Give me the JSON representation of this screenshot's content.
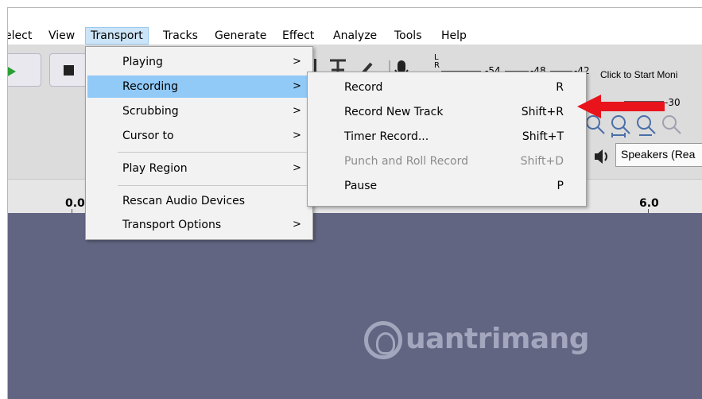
{
  "menubar": {
    "items": [
      "elect",
      "View",
      "Transport",
      "Tracks",
      "Generate",
      "Effect",
      "Analyze",
      "Tools",
      "Help"
    ],
    "open_index": 2
  },
  "meter": {
    "record_label": "L\nR",
    "scale_top": [
      "-54",
      "-48",
      "-42"
    ],
    "scale_bottom": [
      "-30"
    ],
    "monitor_text": "Click to Start Moni"
  },
  "device": {
    "speakers": "Speakers (Rea"
  },
  "ruler": {
    "labels": [
      "0.0",
      "6.0"
    ]
  },
  "transport_menu": {
    "items": [
      {
        "label": "Playing",
        "submenu": true
      },
      {
        "label": "Recording",
        "submenu": true,
        "highlighted": true
      },
      {
        "label": "Scrubbing",
        "submenu": true
      },
      {
        "label": "Cursor to",
        "submenu": true
      },
      {
        "label": "Play Region",
        "submenu": true
      },
      {
        "label": "Rescan Audio Devices",
        "submenu": false
      },
      {
        "label": "Transport Options",
        "submenu": true
      }
    ],
    "arrow": ">"
  },
  "recording_menu": {
    "items": [
      {
        "label": "Record",
        "shortcut": "R",
        "enabled": true
      },
      {
        "label": "Record New Track",
        "shortcut": "Shift+R",
        "enabled": true
      },
      {
        "label": "Timer Record...",
        "shortcut": "Shift+T",
        "enabled": true
      },
      {
        "label": "Punch and Roll Record",
        "shortcut": "Shift+D",
        "enabled": false
      },
      {
        "label": "Pause",
        "shortcut": "P",
        "enabled": true
      }
    ]
  },
  "watermark": {
    "text": "uantrimang"
  },
  "colors": {
    "highlight": "#91c9f7",
    "track_bg": "#626582",
    "arrow": "#e8131b"
  }
}
